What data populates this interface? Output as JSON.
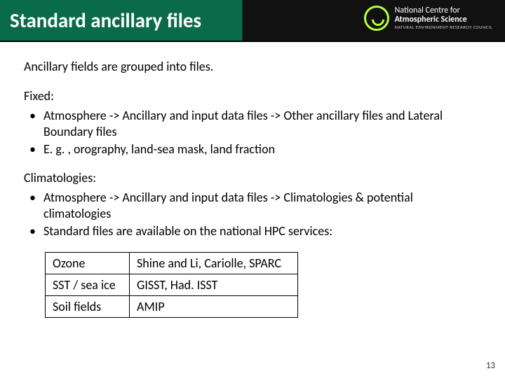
{
  "title": "Standard ancillary files",
  "logo": {
    "line1": "National Centre for",
    "line2": "Atmospheric Science",
    "line3": "NATURAL ENVIRONMENT RESEARCH COUNCIL"
  },
  "intro": "Ancillary fields are grouped into files.",
  "section1": {
    "heading": "Fixed:",
    "bullets": [
      "Atmosphere -> Ancillary and input data files -> Other ancillary files and Lateral Boundary files",
      "E. g. , orography, land-sea mask, land fraction"
    ]
  },
  "section2": {
    "heading": "Climatologies:",
    "bullets": [
      "Atmosphere -> Ancillary and input data files -> Climatologies & potential climatologies",
      "Standard files are available on the national HPC services:"
    ]
  },
  "table": {
    "rows": [
      {
        "c1": "Ozone",
        "c2": "Shine and Li, Cariolle, SPARC"
      },
      {
        "c1": "SST / sea ice",
        "c2": "GISST, Had. ISST"
      },
      {
        "c1": "Soil  fields",
        "c2": "AMIP"
      }
    ]
  },
  "page_number": "13"
}
